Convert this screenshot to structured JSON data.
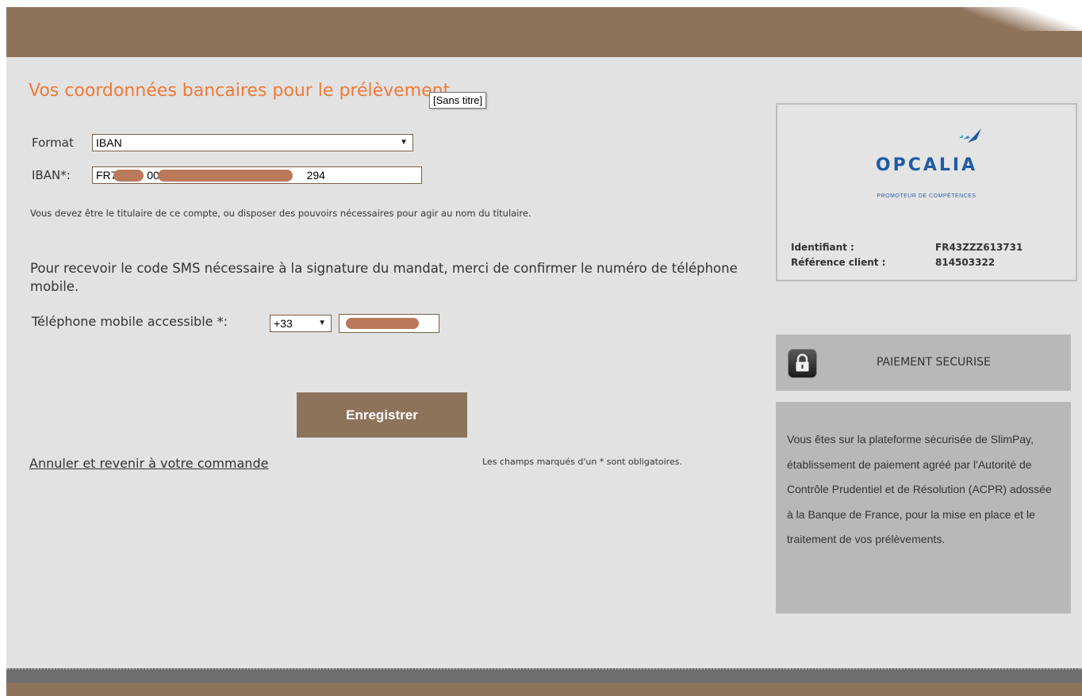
{
  "header": {
    "title": "Vos coordonnées bancaires pour le prélèvement"
  },
  "tooltip": {
    "text": "[Sans titre]"
  },
  "form": {
    "format_label": "Format",
    "format_value": "IBAN",
    "iban_label": "IBAN*:",
    "iban_visible_start": "FR7",
    "iban_visible_mid": "00",
    "iban_visible_end": "294",
    "owner_notice": "Vous devez être le titulaire de ce compte, ou disposer des pouvoirs nécessaires pour agir au nom du titulaire.",
    "sms_instruction": "Pour recevoir le code SMS nécessaire à la signature du mandat, merci de confirmer le numéro de téléphone mobile.",
    "phone_label": "Téléphone mobile accessible *:",
    "phone_prefix": "+33",
    "save_button": "Enregistrer",
    "cancel_link": "Annuler et revenir à votre commande",
    "required_note": "Les champs marqués d'un * sont obligatoires."
  },
  "creditor": {
    "logo_name": "OPCALIA",
    "logo_tagline": "PROMOTEUR DE COMPÉTENCES",
    "identifier_label": "Identifiant :",
    "identifier_value": "FR43ZZZ613731",
    "reference_label": "Référence client :",
    "reference_value": "814503322"
  },
  "secure": {
    "label": "PAIEMENT SECURISE",
    "info": "Vous êtes sur la plateforme sécurisée de SlimPay, établissement de paiement agréé par l'Autorité de Contrôle Prudentiel et de Résolution (ACPR) adossée à la Banque de France, pour la mise en place et le traitement de vos prélèvements."
  },
  "colors": {
    "brand_brown": "#8e735b",
    "title_orange": "#f07a36",
    "logo_blue": "#1f5aa6",
    "panel_gray": "#b8b8b8"
  }
}
